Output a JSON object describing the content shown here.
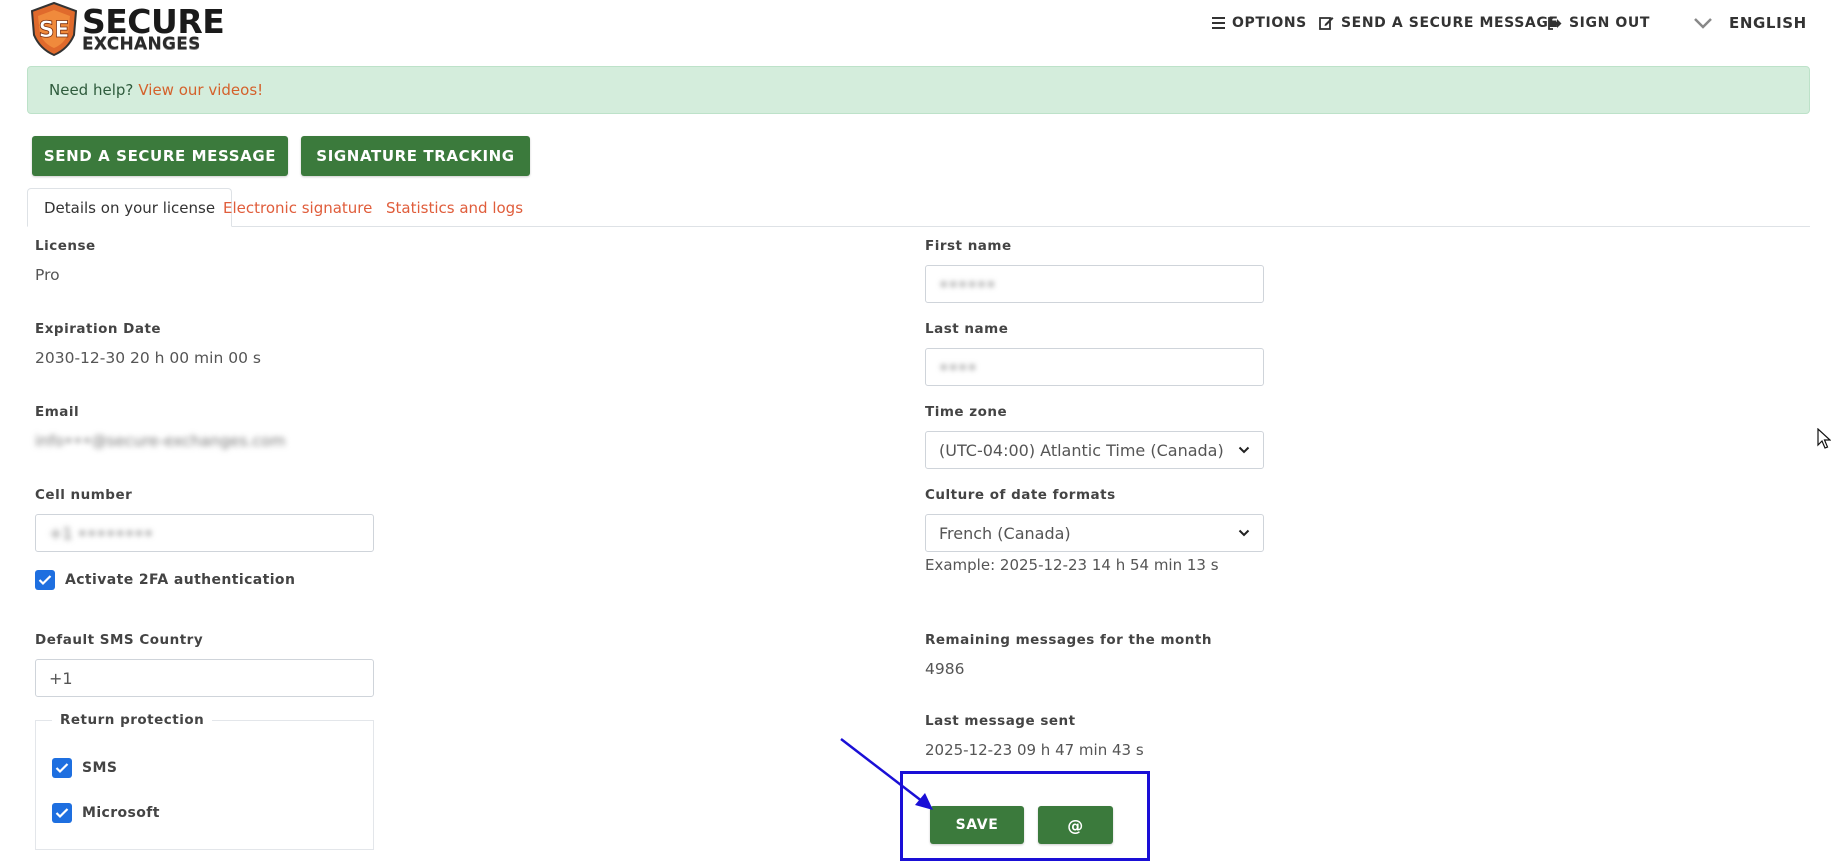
{
  "brand": {
    "line1": "SECURE",
    "line2": "EXCHANGES"
  },
  "topnav": {
    "options": "OPTIONS",
    "send_secure": "SEND A SECURE MESSAGE",
    "sign_out": "SIGN OUT",
    "language": "ENGLISH"
  },
  "alert": {
    "text": "Need help?",
    "link": "View our videos!"
  },
  "actions": {
    "send_secure": "SEND A SECURE MESSAGE",
    "signature_tracking": "SIGNATURE TRACKING"
  },
  "tabs": [
    {
      "label": "Details on your license"
    },
    {
      "label": "Electronic signature"
    },
    {
      "label": "Statistics and logs"
    }
  ],
  "left": {
    "license_label": "License",
    "license_value": "Pro",
    "expiration_label": "Expiration Date",
    "expiration_value": "2030-12-30 20 h 00 min 00 s",
    "email_label": "Email",
    "email_value": "info•••@secure-exchanges.com",
    "cell_label": "Cell number",
    "cell_value": "+1 ••••••••",
    "twofa_label": "Activate 2FA authentication",
    "sms_country_label": "Default SMS Country",
    "sms_country_value": "+1",
    "return_protection_label": "Return protection",
    "sms_label": "SMS",
    "microsoft_label": "Microsoft"
  },
  "right": {
    "first_name_label": "First name",
    "first_name_value": "••••••",
    "last_name_label": "Last name",
    "last_name_value": "••••",
    "timezone_label": "Time zone",
    "timezone_value": "(UTC-04:00) Atlantic Time (Canada)",
    "culture_label": "Culture of date formats",
    "culture_value": "French (Canada)",
    "culture_example": "Example: 2025-12-23 14 h 54 min 13 s",
    "remaining_label": "Remaining messages for the month",
    "remaining_value": "4986",
    "last_sent_label": "Last message sent",
    "last_sent_value": "2025-12-23 09 h 47 min 43 s"
  },
  "buttons": {
    "save": "SAVE",
    "at": "@"
  },
  "colors": {
    "primary_green": "#3b7a3c",
    "accent_orange": "#e05d3b",
    "checkbox_blue": "#1e6fe0",
    "annotation_blue": "#1a0fd6",
    "alert_bg": "#d4eddc"
  },
  "icons": [
    "secure-exchanges-logo",
    "list-icon",
    "edit-icon",
    "sign-out-icon",
    "chevron-down-icon",
    "check-icon",
    "mouse-cursor-icon",
    "annotation-arrow"
  ]
}
